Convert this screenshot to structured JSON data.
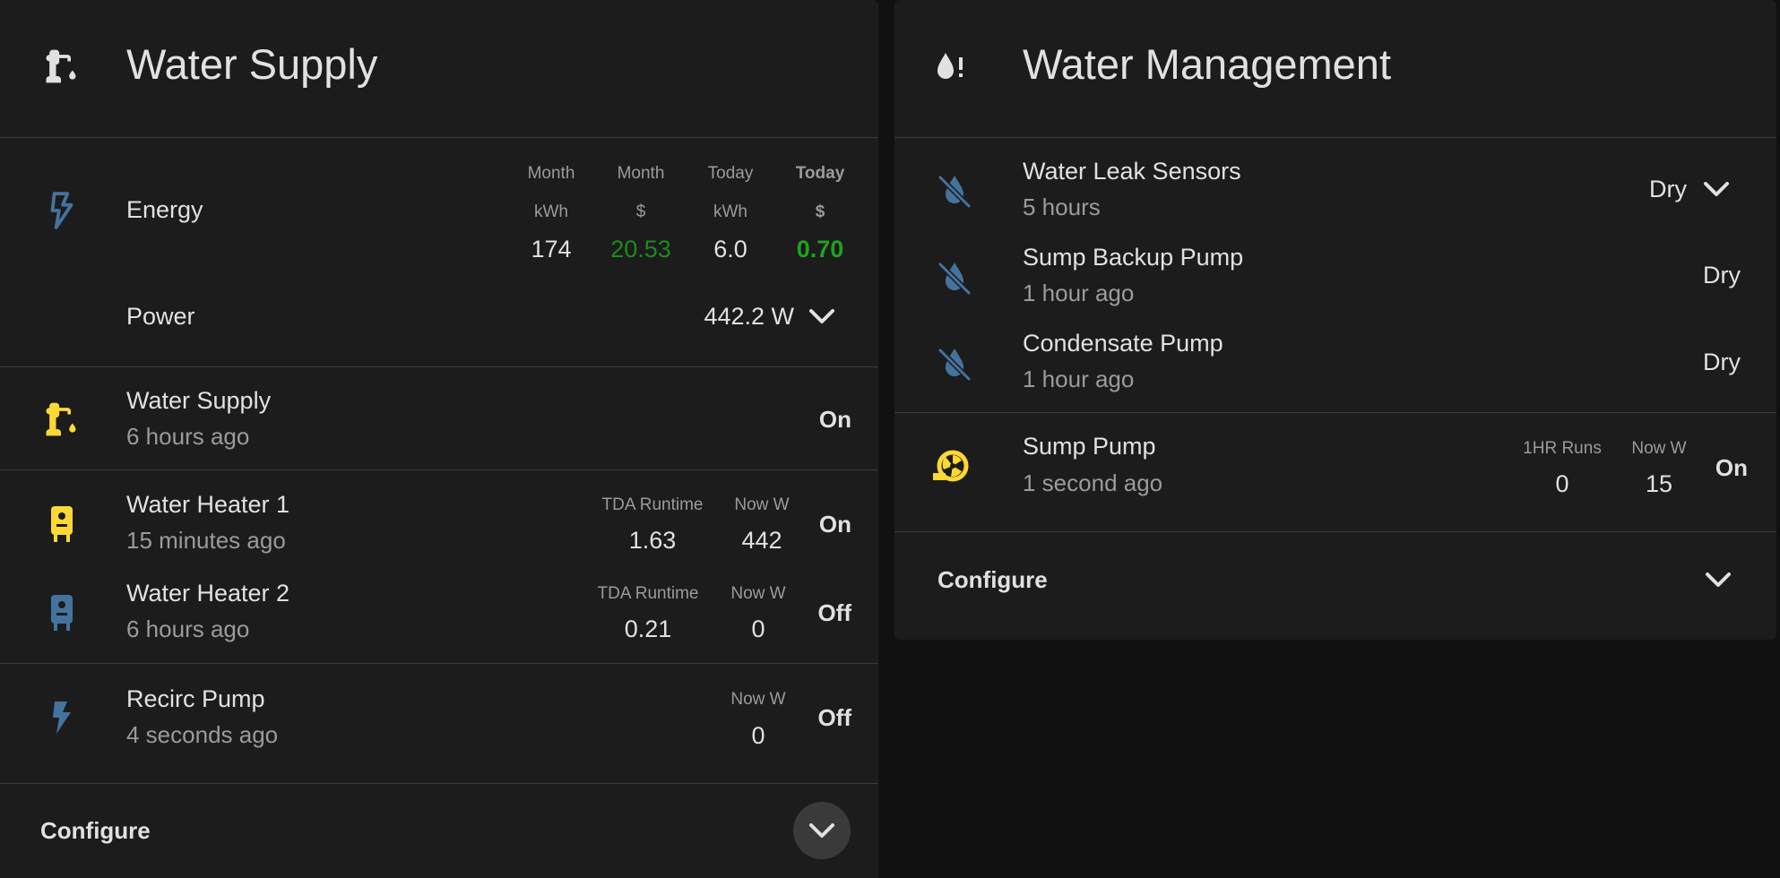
{
  "colors": {
    "card": "#1c1c1c",
    "background": "#111111",
    "icon_blue": "#44739e",
    "icon_yellow": "#fdd835",
    "money_green": "#1c8b1c"
  },
  "water_supply_card": {
    "title": "Water Supply",
    "title_icon": "water-pump-icon",
    "energy": {
      "name": "Energy",
      "icon": "flash-outline-icon",
      "columns": [
        {
          "head1": "Month",
          "head2": "kWh",
          "value": "174"
        },
        {
          "head1": "Month",
          "head2": "$",
          "value": "20.53"
        },
        {
          "head1": "Today",
          "head2": "kWh",
          "value": "6.0"
        },
        {
          "head1": "Today",
          "head2": "$",
          "value": "0.70"
        }
      ]
    },
    "power": {
      "name": "Power",
      "value": "442.2 W"
    },
    "water_supply": {
      "name": "Water Supply",
      "sub": "6 hours ago",
      "state": "On",
      "icon": "water-pump-icon"
    },
    "heater1": {
      "name": "Water Heater 1",
      "sub": "15 minutes ago",
      "attr1_head": "TDA Runtime",
      "attr1_val": "1.63",
      "attr2_head": "Now W",
      "attr2_val": "442",
      "state": "On",
      "icon": "water-boiler-icon"
    },
    "heater2": {
      "name": "Water Heater 2",
      "sub": "6 hours ago",
      "attr1_head": "TDA Runtime",
      "attr1_val": "0.21",
      "attr2_head": "Now W",
      "attr2_val": "0",
      "state": "Off",
      "icon": "water-boiler-icon"
    },
    "recirc": {
      "name": "Recirc Pump",
      "sub": "4 seconds ago",
      "attr_head": "Now W",
      "attr_val": "0",
      "state": "Off",
      "icon": "flash-icon"
    },
    "configure_label": "Configure"
  },
  "water_management_card": {
    "title": "Water Management",
    "title_icon": "water-alert-icon",
    "leak_sensors": {
      "name": "Water Leak Sensors",
      "sub": "5 hours",
      "state": "Dry",
      "icon": "water-off-icon"
    },
    "sump_backup": {
      "name": "Sump Backup Pump",
      "sub": "1 hour ago",
      "state": "Dry",
      "icon": "water-off-icon"
    },
    "condensate": {
      "name": "Condensate Pump",
      "sub": "1 hour ago",
      "state": "Dry",
      "icon": "water-off-icon"
    },
    "sump_pump": {
      "name": "Sump Pump",
      "sub": "1 second ago",
      "attr1_head": "1HR Runs",
      "attr1_val": "0",
      "attr2_head": "Now W",
      "attr2_val": "15",
      "state": "On",
      "icon": "pump-icon"
    },
    "configure_label": "Configure"
  }
}
